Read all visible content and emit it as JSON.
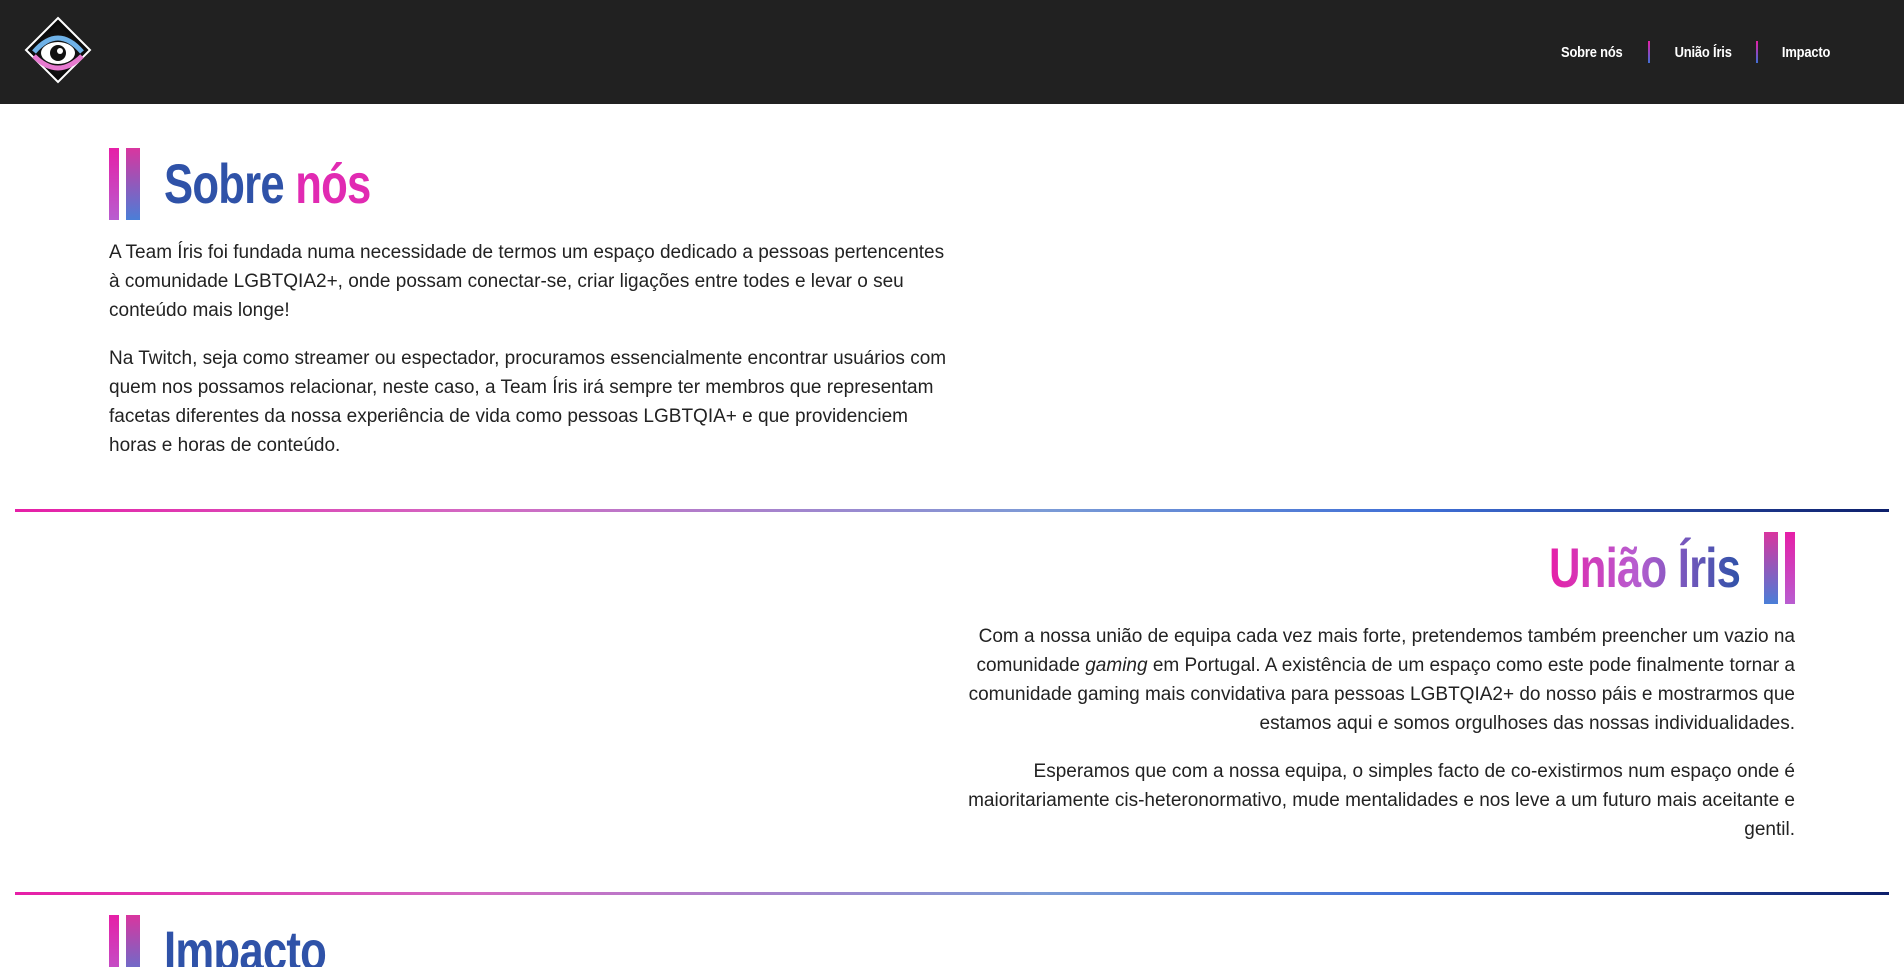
{
  "header": {
    "logo_alt": "Team Íris",
    "nav": [
      {
        "label": "Sobre nós"
      },
      {
        "label": "União Íris"
      },
      {
        "label": "Impacto"
      }
    ]
  },
  "about": {
    "title_part1": "Sobre",
    "title_part2": "nós",
    "paragraphs": [
      "A Team Íris foi fundada numa necessidade de termos um espaço dedicado a pessoas pertencentes à comunidade LGBTQIA2+, onde possam conectar-se, criar ligações entre todes e levar o seu conteúdo mais longe!",
      "Na Twitch, seja como streamer ou espectador, procuramos essencialmente encontrar usuários com quem nos possamos relacionar, neste caso, a Team Íris irá sempre ter membros que representam facetas diferentes da nossa experiência de vida como pessoas LGBTQIA+ e que providenciem horas e horas de conteúdo."
    ]
  },
  "union": {
    "title": "União Íris",
    "p1_before": "Com a nossa união de equipa cada vez mais forte, pretendemos também preencher um vazio na comunidade ",
    "p1_em": "gaming",
    "p1_after": " em Portugal. A existência de um espaço como este pode finalmente tornar a comunidade gaming mais convidativa para pessoas LGBTQIA2+ do nosso páis e mostrarmos que estamos aqui e somos orgulhoses das nossas individualidades.",
    "p2": "Esperamos que com a nossa equipa, o simples facto de co-existirmos num espaço onde é maioritariamente cis-heteronormativo, mude mentalidades e nos leve a um futuro mais aceitante e gentil."
  },
  "impact": {
    "title": "Impacto"
  },
  "colors": {
    "header_bg": "#212121",
    "pink": "#e61fa7",
    "blue": "#2f52a8",
    "navy": "#0d1f6b"
  }
}
